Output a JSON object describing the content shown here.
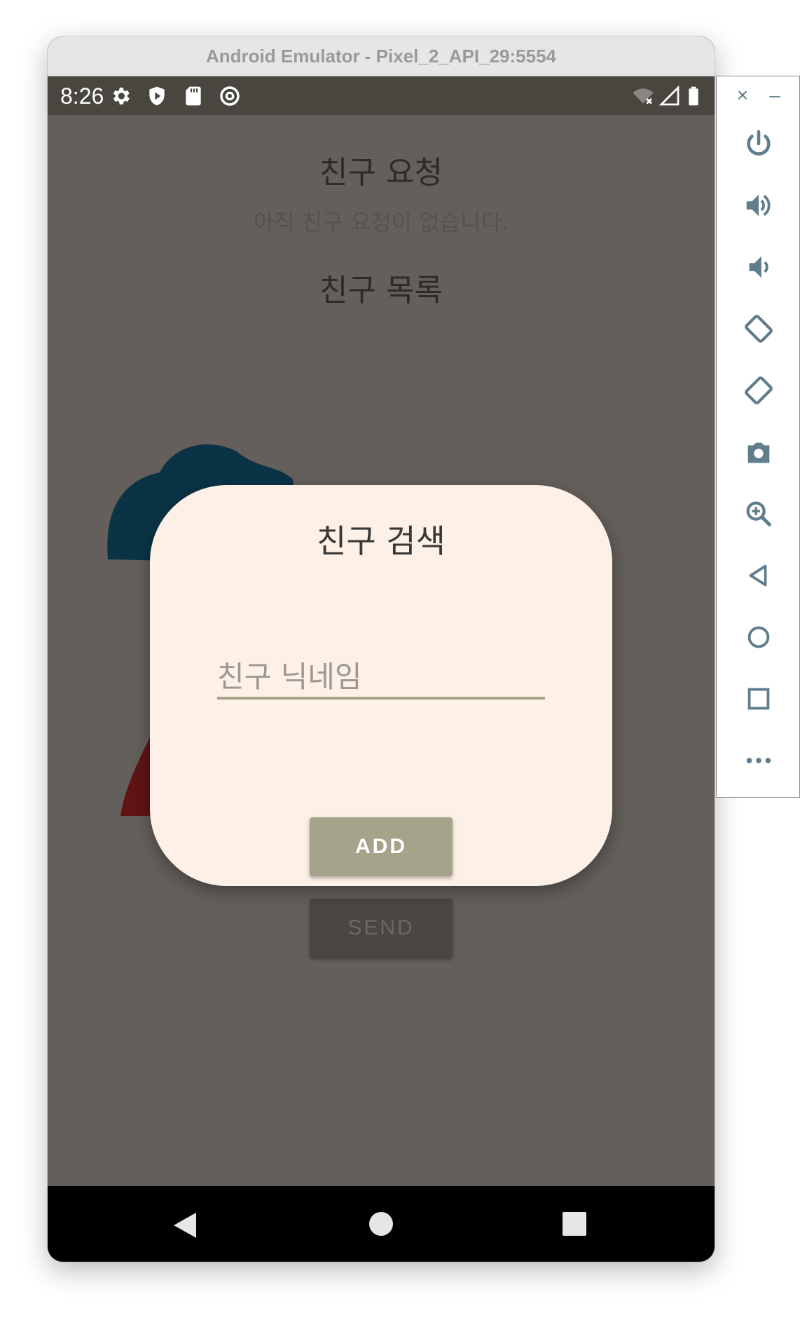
{
  "window": {
    "title": "Android Emulator - Pixel_2_API_29:5554"
  },
  "status_bar": {
    "time": "8:26"
  },
  "screen": {
    "friend_requests_heading": "친구 요청",
    "friend_requests_empty": "아직 친구 요청이 없습니다.",
    "friend_list_heading": "친구 목록",
    "send_label": "SEND"
  },
  "dialog": {
    "title": "친구 검색",
    "nickname_placeholder": "친구 닉네임",
    "nickname_value": "",
    "add_label": "ADD"
  },
  "toolbar": {
    "close_label": "×",
    "minimize_label": "–",
    "items": [
      "power-icon",
      "volume-up-icon",
      "volume-down-icon",
      "rotate-left-icon",
      "rotate-right-icon",
      "camera-icon",
      "zoom-icon",
      "back-icon",
      "home-icon",
      "overview-icon",
      "more-icon"
    ]
  },
  "colors": {
    "screen_bg": "#645f5b",
    "dialog_bg": "#fdf0e6",
    "accent": "#a5a38a",
    "toolbar_icon": "#607d8b"
  }
}
